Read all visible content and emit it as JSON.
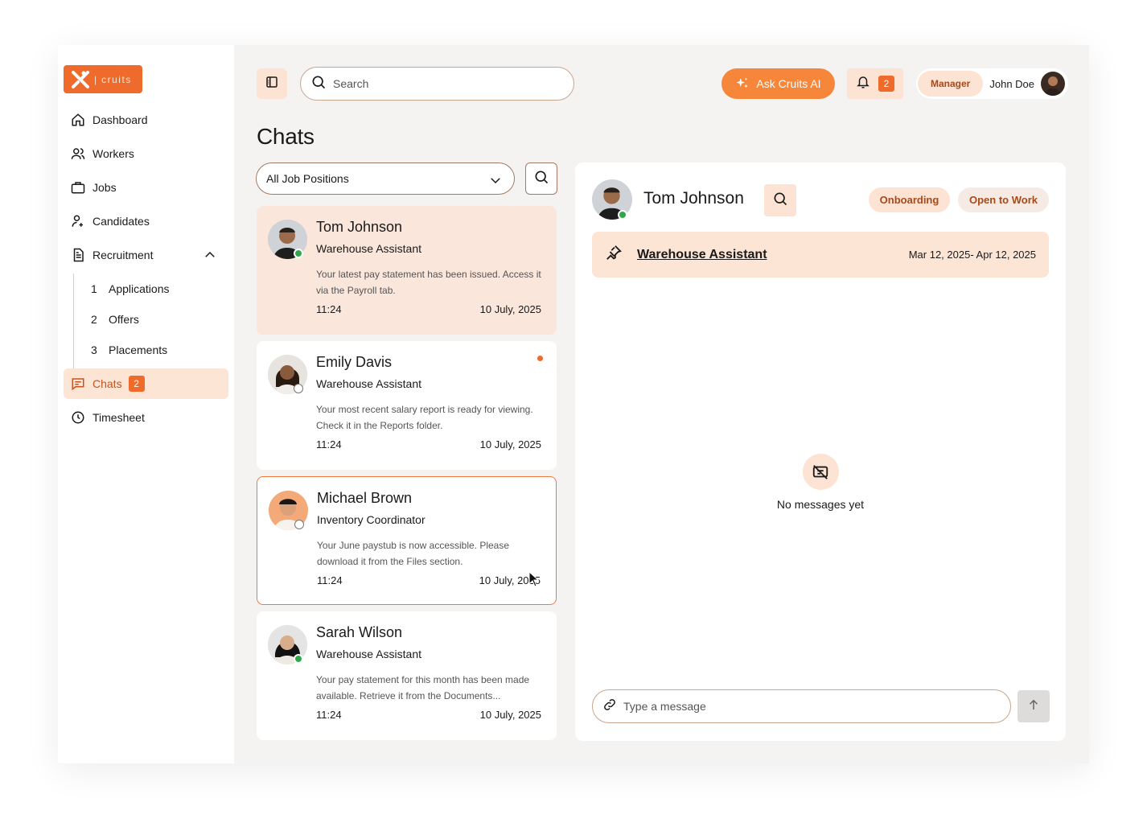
{
  "brand": {
    "logo_text": "cruits",
    "logo_divider": "|"
  },
  "sidebar": {
    "items": [
      {
        "label": "Dashboard",
        "icon": "home-icon"
      },
      {
        "label": "Workers",
        "icon": "users-icon"
      },
      {
        "label": "Jobs",
        "icon": "briefcase-icon"
      },
      {
        "label": "Candidates",
        "icon": "user-plus-icon"
      },
      {
        "label": "Recruitment",
        "icon": "document-icon",
        "expanded": true
      }
    ],
    "recruitment_sub": [
      {
        "num": "1",
        "label": "Applications"
      },
      {
        "num": "2",
        "label": "Offers"
      },
      {
        "num": "3",
        "label": "Placements"
      }
    ],
    "chats": {
      "label": "Chats",
      "badge": "2"
    },
    "timesheet": {
      "label": "Timesheet"
    }
  },
  "header": {
    "search_placeholder": "Search",
    "ask_ai_label": "Ask Cruits AI",
    "notifications_count": "2",
    "role": "Manager",
    "user_name": "John Doe"
  },
  "page": {
    "title": "Chats"
  },
  "filter": {
    "selected": "All Job Positions"
  },
  "chats": [
    {
      "name": "Tom Johnson",
      "role": "Warehouse Assistant",
      "message": "Your latest pay statement has been issued. Access it via the Payroll tab.",
      "time": "11:24",
      "date": "10 July, 2025",
      "status": "online",
      "unread": false
    },
    {
      "name": "Emily Davis",
      "role": "Warehouse Assistant",
      "message": "Your most recent salary report is ready for viewing. Check it in the Reports folder.",
      "time": "11:24",
      "date": "10 July, 2025",
      "status": "offline",
      "unread": true
    },
    {
      "name": "Michael Brown",
      "role": "Inventory Coordinator",
      "message": "Your June paystub is now accessible. Please download it from the Files section.",
      "time": "11:24",
      "date": "10 July, 2025",
      "status": "offline",
      "unread": false
    },
    {
      "name": "Sarah Wilson",
      "role": "Warehouse Assistant",
      "message": "Your pay statement for this month has been made available. Retrieve it from the Documents...",
      "time": "11:24",
      "date": "10 July, 2025",
      "status": "online",
      "unread": false
    }
  ],
  "conversation": {
    "name": "Tom Johnson",
    "tags": [
      "Onboarding",
      "Open to Work"
    ],
    "pinned_job": "Warehouse Assistant",
    "pinned_dates": "Mar 12, 2025- Apr 12, 2025",
    "empty_text": "No messages yet",
    "composer_placeholder": "Type a message"
  },
  "colors": {
    "accent": "#ee6b2c",
    "accent_light": "#fde3d4",
    "online": "#2ea84a"
  }
}
